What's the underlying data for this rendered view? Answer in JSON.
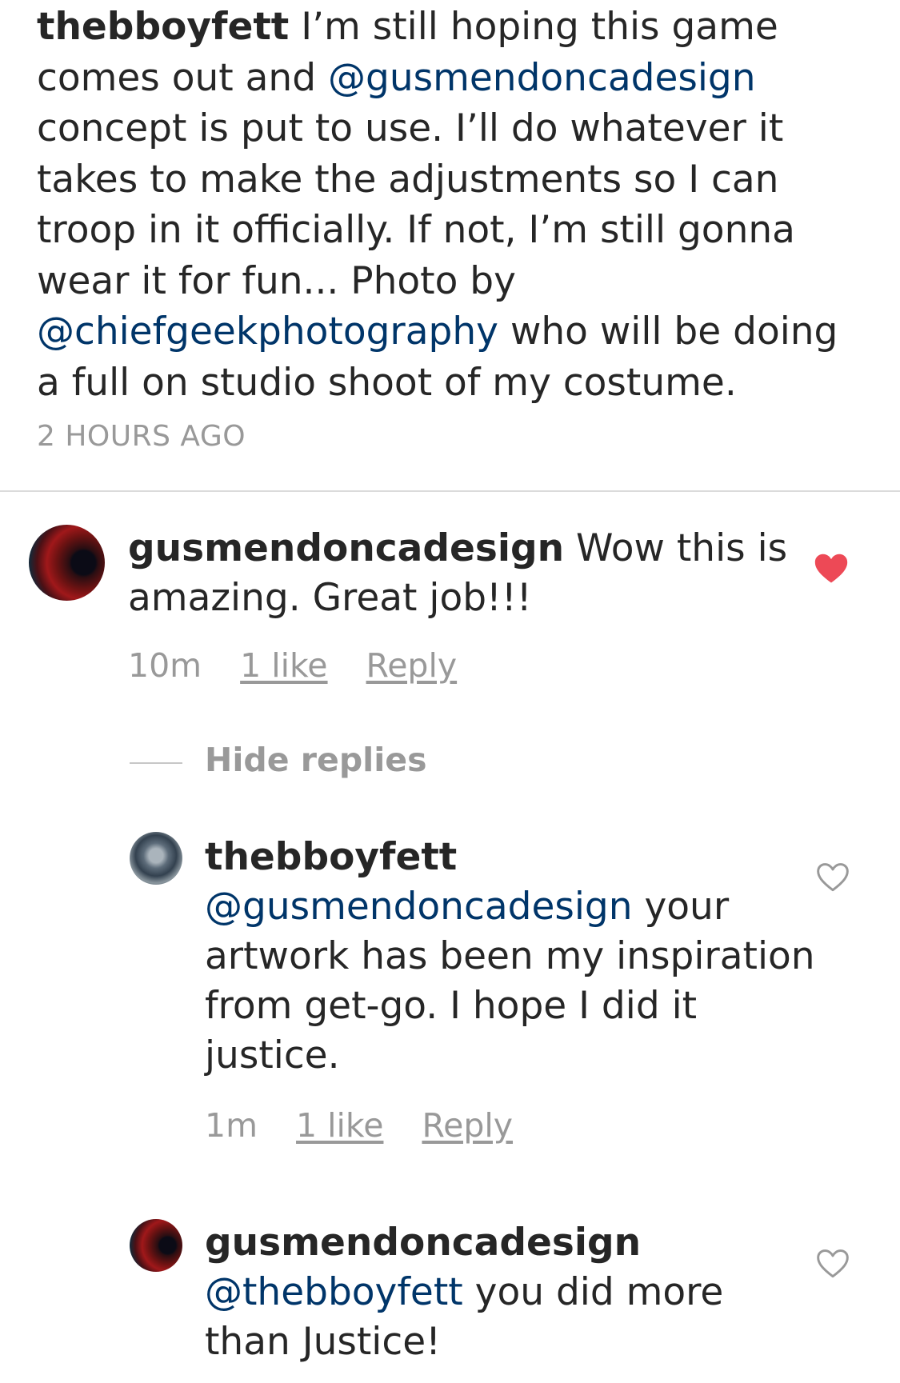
{
  "caption": {
    "username": "thebboyfett",
    "segments": [
      {
        "type": "text",
        "value": " I’m still hoping this game comes out and "
      },
      {
        "type": "mention",
        "value": "@gusmendoncadesign"
      },
      {
        "type": "text",
        "value": " concept is put to use.  I’ll do whatever it takes to make the adjustments so I can troop in it officially.  If not, I’m still gonna wear it for fun... Photo by "
      },
      {
        "type": "mention",
        "value": "@chiefgeekphotography"
      },
      {
        "type": "text",
        "value": " who will be doing a full on studio shoot of my costume."
      }
    ],
    "timestamp": "2 HOURS AGO"
  },
  "comments": [
    {
      "username": "gusmendoncadesign",
      "text": " Wow this is amazing. Great job!!!",
      "time": "10m",
      "likes": "1 like",
      "reply": "Reply",
      "liked": true
    }
  ],
  "hide_replies": "Hide replies",
  "replies": [
    {
      "username": "thebboyfett",
      "mention": "@gusmendoncadesign",
      "text": " your artwork has been my inspiration from get-go.  I hope I did it justice.",
      "time": "1m",
      "likes": "1 like",
      "reply": "Reply",
      "liked": false
    },
    {
      "username": "gusmendoncadesign",
      "mention": "@thebboyfett",
      "text": " you did more than Justice!",
      "liked": false
    }
  ],
  "colors": {
    "mention": "#003569",
    "liked_heart": "#ed4956",
    "muted": "#999999"
  },
  "icons": {
    "liked": "heart-filled-icon",
    "unliked": "heart-outline-icon"
  }
}
